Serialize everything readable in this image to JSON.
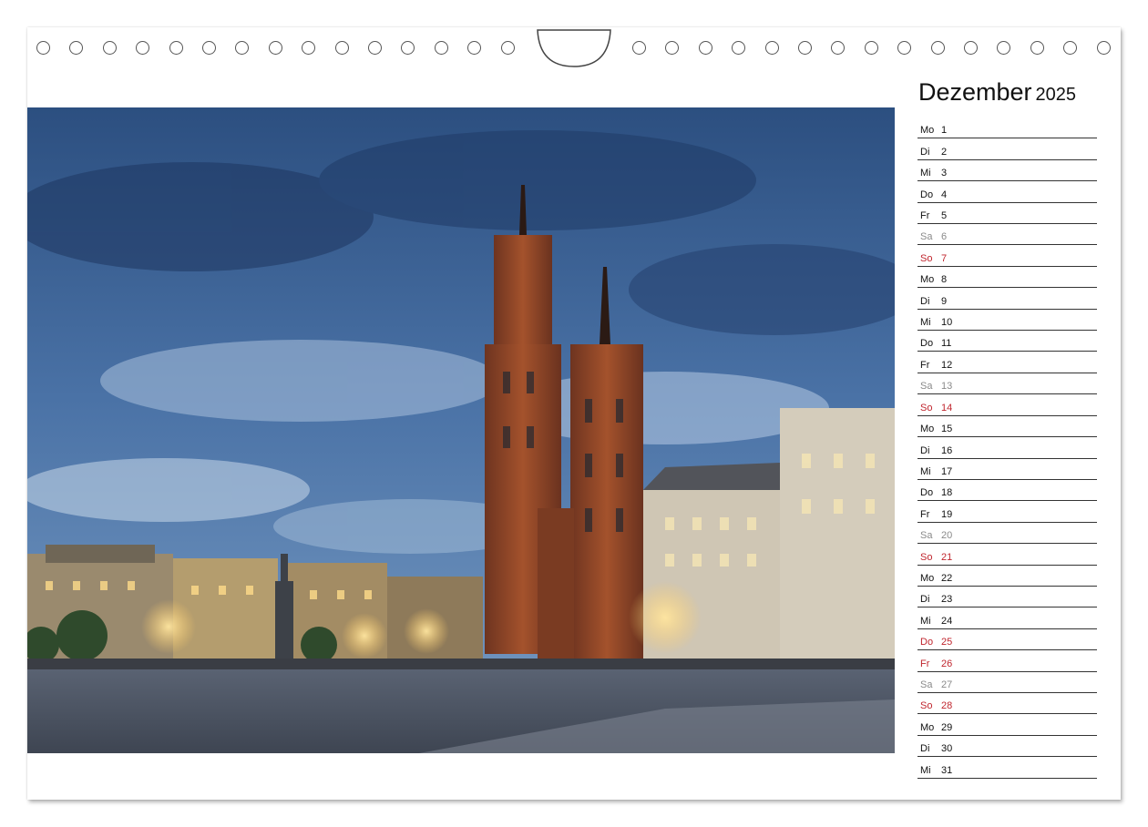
{
  "calendar": {
    "month": "Dezember",
    "year": "2025",
    "days": [
      {
        "dn": "Mo",
        "d": "1",
        "type": "weekday"
      },
      {
        "dn": "Di",
        "d": "2",
        "type": "weekday"
      },
      {
        "dn": "Mi",
        "d": "3",
        "type": "weekday"
      },
      {
        "dn": "Do",
        "d": "4",
        "type": "weekday"
      },
      {
        "dn": "Fr",
        "d": "5",
        "type": "weekday"
      },
      {
        "dn": "Sa",
        "d": "6",
        "type": "sat"
      },
      {
        "dn": "So",
        "d": "7",
        "type": "sun"
      },
      {
        "dn": "Mo",
        "d": "8",
        "type": "weekday"
      },
      {
        "dn": "Di",
        "d": "9",
        "type": "weekday"
      },
      {
        "dn": "Mi",
        "d": "10",
        "type": "weekday"
      },
      {
        "dn": "Do",
        "d": "11",
        "type": "weekday"
      },
      {
        "dn": "Fr",
        "d": "12",
        "type": "weekday"
      },
      {
        "dn": "Sa",
        "d": "13",
        "type": "sat"
      },
      {
        "dn": "So",
        "d": "14",
        "type": "sun"
      },
      {
        "dn": "Mo",
        "d": "15",
        "type": "weekday"
      },
      {
        "dn": "Di",
        "d": "16",
        "type": "weekday"
      },
      {
        "dn": "Mi",
        "d": "17",
        "type": "weekday"
      },
      {
        "dn": "Do",
        "d": "18",
        "type": "weekday"
      },
      {
        "dn": "Fr",
        "d": "19",
        "type": "weekday"
      },
      {
        "dn": "Sa",
        "d": "20",
        "type": "sat"
      },
      {
        "dn": "So",
        "d": "21",
        "type": "sun"
      },
      {
        "dn": "Mo",
        "d": "22",
        "type": "weekday"
      },
      {
        "dn": "Di",
        "d": "23",
        "type": "weekday"
      },
      {
        "dn": "Mi",
        "d": "24",
        "type": "weekday"
      },
      {
        "dn": "Do",
        "d": "25",
        "type": "sun"
      },
      {
        "dn": "Fr",
        "d": "26",
        "type": "sun"
      },
      {
        "dn": "Sa",
        "d": "27",
        "type": "sat"
      },
      {
        "dn": "So",
        "d": "28",
        "type": "sun"
      },
      {
        "dn": "Mo",
        "d": "29",
        "type": "weekday"
      },
      {
        "dn": "Di",
        "d": "30",
        "type": "weekday"
      },
      {
        "dn": "Mi",
        "d": "31",
        "type": "weekday"
      }
    ]
  },
  "colors": {
    "weekday_text": "#111111",
    "saturday_text": "#8a8a8a",
    "sunday_holiday_text": "#c0262e",
    "sky": "#3d6496",
    "brick": "#8a4226"
  },
  "photo": {
    "subject": "market-square-church-at-dusk"
  },
  "binding": {
    "icon": "spiral-binding-holes"
  }
}
